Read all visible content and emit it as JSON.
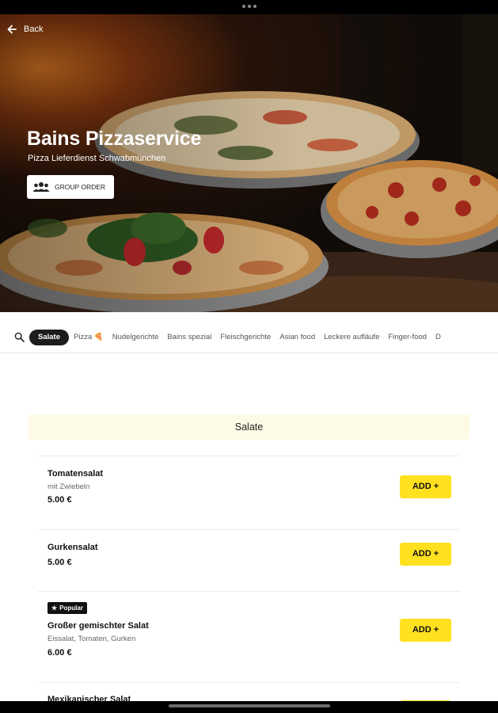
{
  "hero": {
    "back_label": "Back",
    "title": "Bains Pizzaservice",
    "subtitle": "Pizza Lieferdienst Schwabmünchen",
    "group_order_label": "GROUP ORDER"
  },
  "categories": [
    {
      "label": "Salate",
      "active": true
    },
    {
      "label": "Pizza 🍕"
    },
    {
      "label": "Nudelgerichte"
    },
    {
      "label": "Bains spezial"
    },
    {
      "label": "Fleischgerichte"
    },
    {
      "label": "Asian food"
    },
    {
      "label": "Leckere aufläufe"
    },
    {
      "label": "Finger-food"
    },
    {
      "label": "D"
    }
  ],
  "section": {
    "title": "Salate"
  },
  "items": [
    {
      "name": "Tomatensalat",
      "description": "mit Zwiebeln",
      "price": "5.00 €",
      "add_label": "ADD +"
    },
    {
      "name": "Gurkensalat",
      "price": "5.00 €",
      "add_label": "ADD +"
    },
    {
      "badge": "Popular",
      "name": "Großer gemischter Salat",
      "description": "Eissalat, Tomaten, Gurken",
      "price": "6.00 €",
      "add_label": "ADD +"
    },
    {
      "name": "Mexikanischer Salat"
    }
  ],
  "colors": {
    "accent": "#ffe11f",
    "section_bg": "#fdfbe6",
    "active_tab": "#1d1d1d"
  },
  "icons": [
    "arrow-left-icon",
    "group-icon",
    "search-icon",
    "star-icon"
  ]
}
